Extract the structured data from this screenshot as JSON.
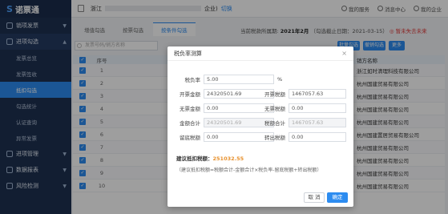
{
  "app": {
    "logo_mark": "S",
    "logo_text": "诺票通"
  },
  "sidebar": {
    "groups": [
      {
        "label": "销项发票",
        "open": false
      },
      {
        "label": "进项勾选",
        "open": true
      }
    ],
    "items": [
      {
        "label": "发票总览",
        "active": false
      },
      {
        "label": "发票签收",
        "active": false
      },
      {
        "label": "抵扣勾选",
        "active": true
      },
      {
        "label": "勾选统计",
        "active": false
      },
      {
        "label": "认证查询",
        "active": false
      },
      {
        "label": "异常发票",
        "active": false
      }
    ],
    "bottom_groups": [
      {
        "label": "进项管理"
      },
      {
        "label": "数据报表"
      },
      {
        "label": "风险检测"
      }
    ]
  },
  "header": {
    "company_prefix": "浙江",
    "company_suffix": "企业)",
    "switch_label": "切换",
    "service_label": "我的服务",
    "message_label": "消息中心",
    "my_company_label": "我的企业"
  },
  "tabs": [
    "增值勾选",
    "按票勾选",
    "按条件勾选"
  ],
  "period": {
    "label": "当前税款所属期:",
    "value": "2021年2月",
    "deadline": "（勾选截止日期：2021-03-15）",
    "warn": "◎ 暂未失去未来"
  },
  "toolbar": {
    "search_placeholder": "发票号码/销方名称",
    "btn_a": "批量勾选",
    "btn_b": "撤销勾选",
    "btn_c": "更多"
  },
  "table": {
    "headers": [
      "序号",
      "发票代码",
      "销方名称"
    ],
    "rows": [
      {
        "no": "1",
        "code": "3302172130",
        "vendor": "浙江如时清理科技有限公司"
      },
      {
        "no": "2",
        "code": "3300182130",
        "vendor": "杭州国建贸易有限公司"
      },
      {
        "no": "3",
        "code": "3300182130",
        "vendor": "杭州国建贸易有限公司"
      },
      {
        "no": "4",
        "code": "3300182130",
        "vendor": "杭州国建贸易有限公司"
      },
      {
        "no": "5",
        "code": "3300182130",
        "vendor": "杭州国建贸易有限公司"
      },
      {
        "no": "6",
        "code": "3300182130",
        "vendor": "杭州国建置居贸易有限公司"
      },
      {
        "no": "7",
        "code": "3300182130",
        "vendor": "杭州国建贸易有限公司"
      },
      {
        "no": "8",
        "code": "3300182130",
        "vendor": "杭州国建贸易有限公司"
      },
      {
        "no": "9",
        "code": "3300182130",
        "vendor": "杭州国建贸易有限公司"
      },
      {
        "no": "10",
        "code": "3200182130",
        "vendor": "杭州国建贸易有限公司"
      }
    ]
  },
  "dialog": {
    "title": "税负率测算",
    "close_icon": "×",
    "tax_rate_label": "税负率",
    "tax_rate_value": "5.00",
    "tax_rate_unit": "%",
    "fields": [
      {
        "label": "开票金额",
        "value": "24320501.69",
        "disabled": false
      },
      {
        "label": "开票税额",
        "value": "1467057.63",
        "disabled": false
      },
      {
        "label": "无票金额",
        "value": "0.00",
        "disabled": false
      },
      {
        "label": "无票税额",
        "value": "0.00",
        "disabled": false
      },
      {
        "label": "金额合计",
        "value": "24320501.69",
        "disabled": true
      },
      {
        "label": "税额合计",
        "value": "1467057.63",
        "disabled": true
      },
      {
        "label": "留底税额",
        "value": "0.00",
        "disabled": false
      },
      {
        "label": "转出税额",
        "value": "0.00",
        "disabled": false
      }
    ],
    "deduct_label": "建议抵扣税额：",
    "deduct_value": "251032.55",
    "formula": "（建议抵扣税额=税额合计-金额合计×税负率-留底税额+转出税额）",
    "cancel_label": "取 消",
    "ok_label": "确定"
  }
}
